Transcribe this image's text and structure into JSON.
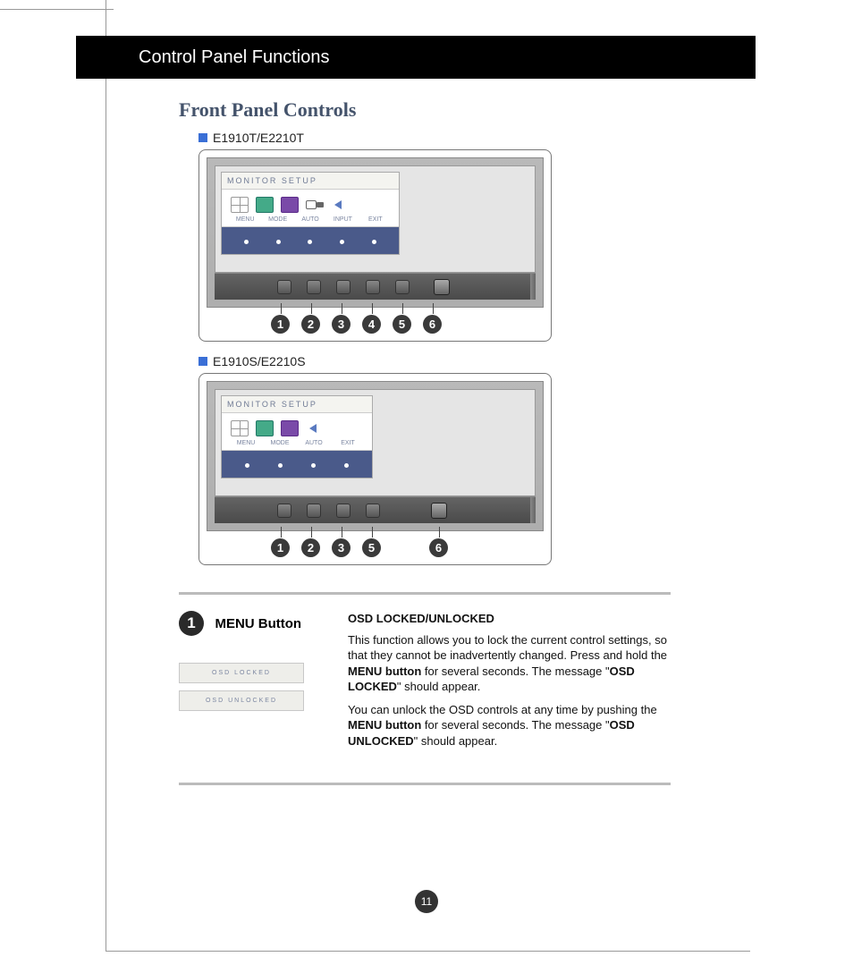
{
  "header": {
    "title": "Control Panel Functions"
  },
  "main_title": "Front Panel Controls",
  "model_a": "E1910T/E2210T",
  "model_b": "E1910S/E2210S",
  "osd": {
    "title": "MONITOR SETUP",
    "labels_a": [
      "MENU",
      "MODE",
      "AUTO",
      "INPUT",
      "EXIT"
    ],
    "labels_b": [
      "MENU",
      "MODE",
      "AUTO",
      "EXIT"
    ]
  },
  "callouts_a": [
    "1",
    "2",
    "3",
    "4",
    "5",
    "6"
  ],
  "callouts_b": [
    "1",
    "2",
    "3",
    "5",
    "6"
  ],
  "section1": {
    "num": "1",
    "title": "MENU Button",
    "locked": "OSD LOCKED",
    "unlocked": "OSD UNLOCKED",
    "heading": "OSD LOCKED/UNLOCKED",
    "p1a": "This function allows you to lock the current control settings, so that they cannot be inadvertently changed. Press and hold the ",
    "p1b": "MENU button",
    "p1c": " for several seconds. The message \"",
    "p1d": "OSD LOCKED",
    "p1e": "\" should appear.",
    "p2a": "You can unlock the OSD controls at any time by pushing the ",
    "p2b": "MENU button",
    "p2c": " for several seconds. The message \"",
    "p2d": "OSD UNLOCKED",
    "p2e": "\" should appear."
  },
  "page_number": "11"
}
